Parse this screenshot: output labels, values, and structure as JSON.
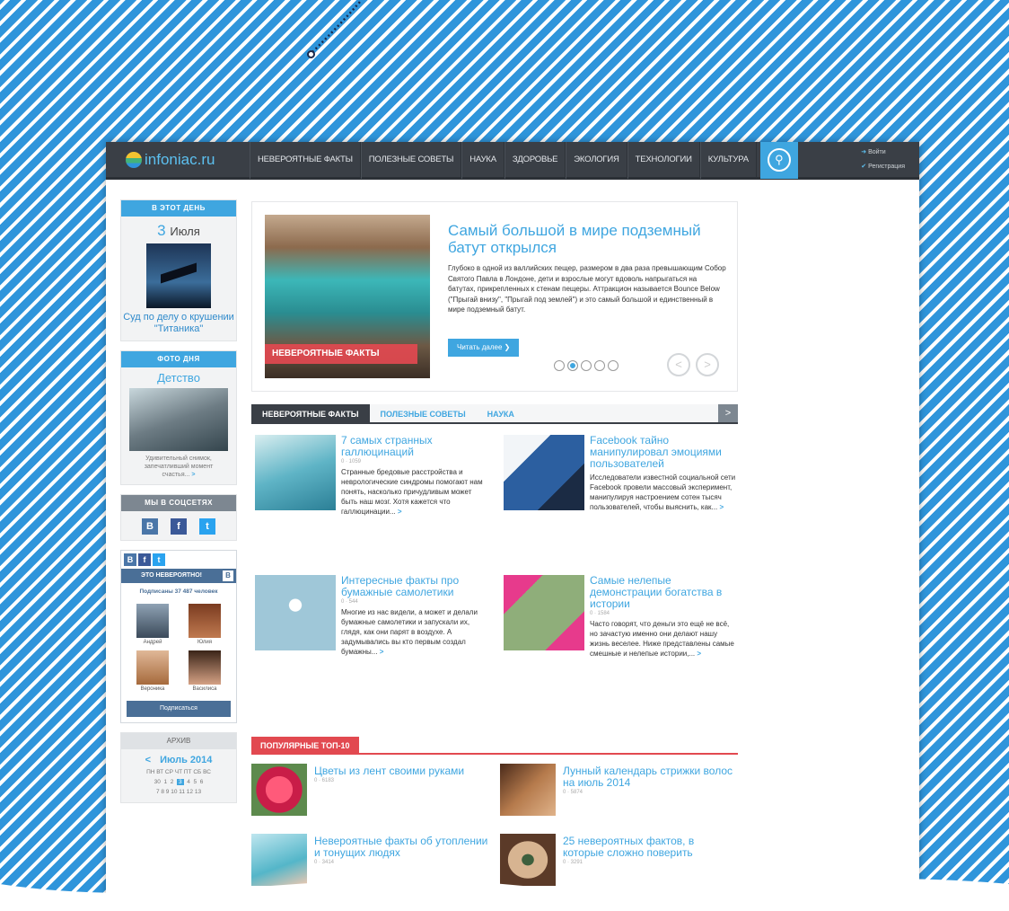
{
  "brand": {
    "name": "infoniac.ru"
  },
  "nav": {
    "items": [
      "НЕВЕРОЯТНЫЕ ФАКТЫ",
      "ПОЛЕЗНЫЕ СОВЕТЫ",
      "НАУКА",
      "ЗДОРОВЬЕ",
      "ЭКОЛОГИЯ",
      "ТЕХНОЛОГИИ",
      "КУЛЬТУРА"
    ]
  },
  "auth": {
    "login": "Войти",
    "register": "Регистрация"
  },
  "sidebar": {
    "on_this_day": {
      "heading": "В ЭТОТ ДЕНЬ",
      "day": "3",
      "month": "Июля",
      "caption": "Суд по делу о крушении \"Титаника\""
    },
    "photo_day": {
      "heading": "ФОТО ДНЯ",
      "title": "Детство",
      "caption": "Удивительный снимок, запечатливший момент счастья...",
      "more": ">"
    },
    "social": {
      "heading": "МЫ В СОЦСЕТЯХ",
      "vk": "В",
      "fb": "f",
      "tw": "t"
    },
    "vk_widget": {
      "tabs": [
        "В",
        "f",
        "t"
      ],
      "group": "ЭТО НЕВЕРОЯТНО!",
      "subscribers": "Подписаны 37 487 человек",
      "members": [
        "Андрей",
        "Юлия",
        "Вероника",
        "Василиса"
      ],
      "button": "Подписаться"
    },
    "archive": {
      "heading": "АРХИВ",
      "month": "Июль 2014",
      "prev": "<",
      "weekdays": "ПН ВТ СР ЧТ ПТ СБ ВС",
      "row1": [
        "30",
        "1",
        "2",
        "3",
        "4",
        "5",
        "6"
      ],
      "row2": "7 8 9 10 11 12 13",
      "selected": "3"
    }
  },
  "slider": {
    "badge": "НЕВЕРОЯТНЫЕ ФАКТЫ",
    "title": "Самый большой в мире подземный батут открылся",
    "text": "Глубоко в одной из валлийских пещер, размером в два раза превышающим Собор Святого Павла в Лондоне, дети и взрослые могут вдоволь напрыгаться на батутах, прикрепленных к стенам пещеры. Аттракцион называется Bounce Below (\"Прыгай внизу\", \"Прыгай под землей\") и это самый большой и единственный в мире подземный батут.",
    "read_more": "Читать далее",
    "prev": "<",
    "next": ">"
  },
  "tabs": [
    "НЕВЕРОЯТНЫЕ ФАКТЫ",
    "ПОЛЕЗНЫЕ СОВЕТЫ",
    "НАУКА"
  ],
  "tab_next": ">",
  "articles": [
    {
      "title": "7 самых странных галлюцинаций",
      "meta": "0 · 1059",
      "text": "Странные бредовые расстройства и неврологические синдромы помогают нам понять, насколько причудливым может быть наш мозг. Хотя кажется что галлюцинации...",
      "more": ">"
    },
    {
      "title": "Facebook тайно манипулировал эмоциями пользователей",
      "meta": "",
      "text": "Исследователи известной социальной сети Facebook провели массовый эксперимент, манипулируя настроением сотен тысяч пользователей, чтобы выяснить, как...",
      "more": ">"
    },
    {
      "title": "Интересные факты про бумажные самолетики",
      "meta": "0 · 544",
      "text": "Многие из нас видели, а может и делали бумажные самолетики и запускали их, глядя, как они парят в воздухе. А задумывались вы кто первым создал бумажны...",
      "more": ">"
    },
    {
      "title": "Самые нелепые демонстрации богатства в истории",
      "meta": "0 · 1584",
      "text": "Часто говорят, что деньги это ещё не всё, но зачастую именно они делают нашу жизнь веселее. Ниже представлены самые смешные и нелепые истории,...",
      "more": ">"
    }
  ],
  "popular": {
    "heading": "ПОПУЛЯРНЫЕ ТОП-10",
    "items": [
      {
        "title": "Цветы из лент своими руками",
        "meta": "0 · 6183"
      },
      {
        "title": "Лунный календарь стрижки волос на июль 2014",
        "meta": "0 · 5874"
      },
      {
        "title": "Невероятные факты об утоплении и тонущих людях",
        "meta": "0 · 3414"
      },
      {
        "title": "25 невероятных фактов, в которые сложно поверить",
        "meta": "0 · 3291"
      }
    ]
  },
  "colors": {
    "accent": "#3fa6e0",
    "nav_bg": "#3a3f46",
    "red": "#e24950",
    "pattern": "#2f95db"
  },
  "icons": {
    "search": "search-icon",
    "login": "login-icon",
    "register": "check-icon"
  }
}
